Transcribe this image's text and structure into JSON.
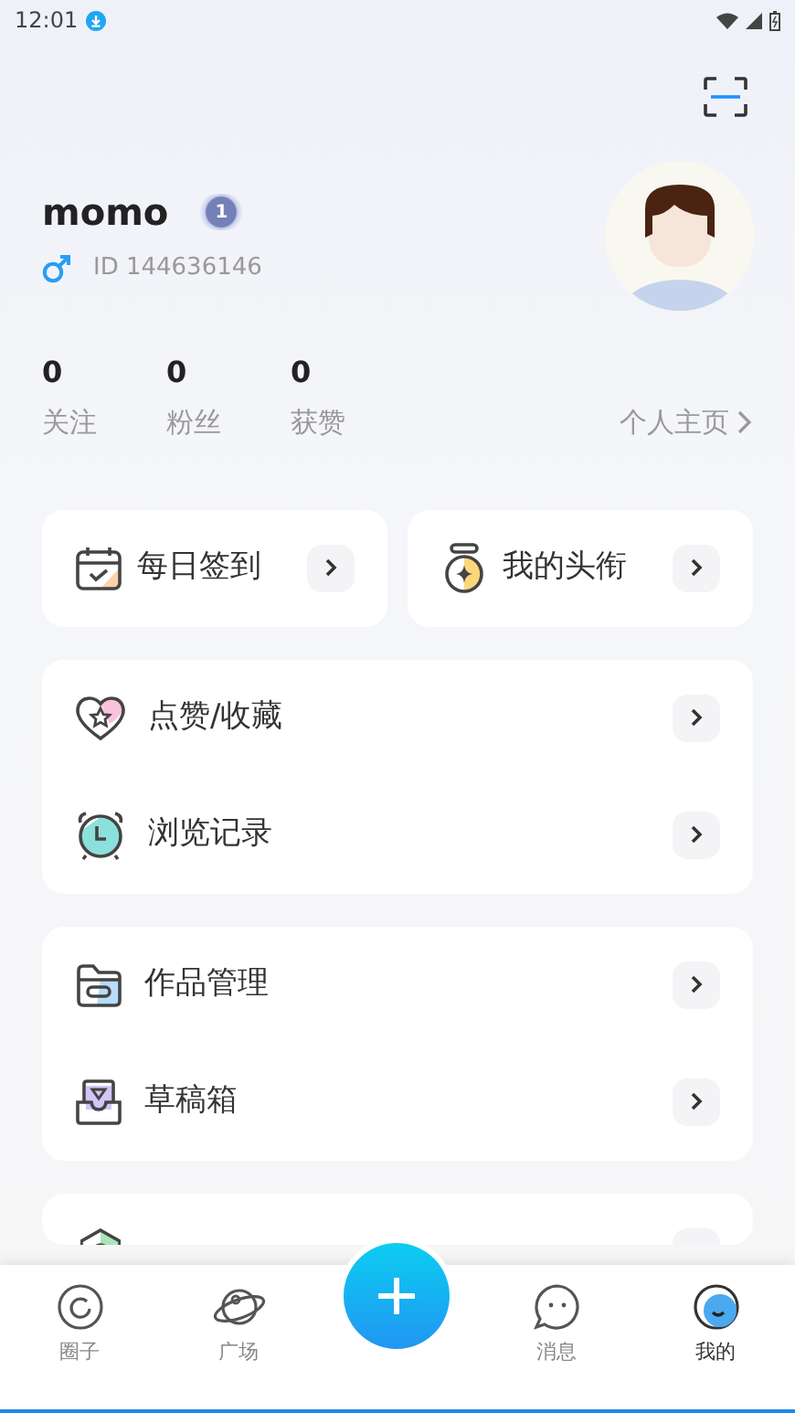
{
  "status_bar": {
    "time": "12:01"
  },
  "profile": {
    "name": "momo",
    "level": "1",
    "id": "ID 144636146"
  },
  "stats": [
    {
      "value": "0",
      "label": "关注"
    },
    {
      "value": "0",
      "label": "粉丝"
    },
    {
      "value": "0",
      "label": "获赞"
    }
  ],
  "homepage_link": "个人主页",
  "quick_cards": [
    {
      "label": "每日签到"
    },
    {
      "label": "我的头衔"
    }
  ],
  "menu_groups": [
    {
      "items": [
        {
          "label": "点赞/收藏"
        },
        {
          "label": "浏览记录"
        }
      ]
    },
    {
      "items": [
        {
          "label": "作品管理"
        },
        {
          "label": "草稿箱"
        }
      ]
    }
  ],
  "more_below": true,
  "tab_bar": {
    "tabs": [
      {
        "label": "圈子",
        "selected": false
      },
      {
        "label": "广场",
        "selected": false
      },
      {
        "label": "消息",
        "selected": false
      },
      {
        "label": "我的",
        "selected": true
      }
    ]
  }
}
